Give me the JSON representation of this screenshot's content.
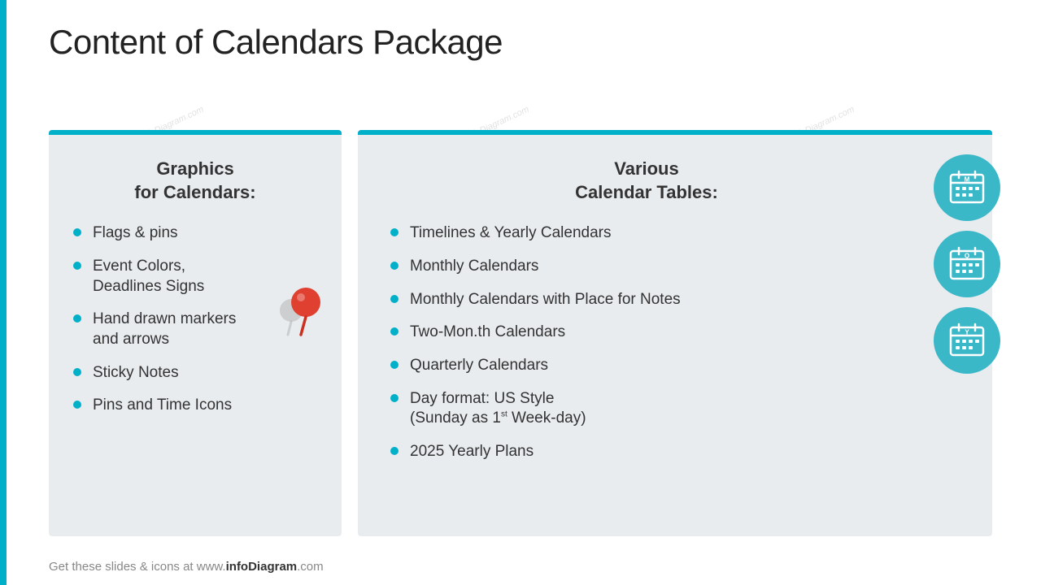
{
  "page": {
    "title": "Content of Calendars Package",
    "left_accent_color": "#00b0c8"
  },
  "left_panel": {
    "title_line1": "Graphics",
    "title_line2": "for Calendars:",
    "items": [
      "Flags & pins",
      "Event Colors, Deadlines Signs",
      "Hand drawn markers and arrows",
      "Sticky Notes",
      "Pins and Time Icons"
    ]
  },
  "right_panel": {
    "title_line1": "Various",
    "title_line2": "Calendar Tables:",
    "items": [
      {
        "text": "Timelines & Yearly Calendars",
        "sup": null
      },
      {
        "text": "Monthly Calendars",
        "sup": null
      },
      {
        "text": "Monthly Calendars with Place for Notes",
        "sup": null
      },
      {
        "text": "Two-Mon.th Calendars",
        "sup": null
      },
      {
        "text": "Quarterly Calendars",
        "sup": null
      },
      {
        "text": "Day format: US Style (Sunday as 1st Week-day)",
        "sup": "st"
      },
      {
        "text": "2025 Yearly Plans",
        "sup": null
      }
    ]
  },
  "calendar_icons": [
    {
      "letter": "M",
      "aria": "monthly-calendar-icon"
    },
    {
      "letter": "Q",
      "aria": "quarterly-calendar-icon"
    },
    {
      "letter": "Y",
      "aria": "yearly-calendar-icon"
    }
  ],
  "footer": {
    "text_before": "Get these slides & icons at www.",
    "brand": "infoDiagram",
    "text_after": ".com"
  },
  "watermarks": [
    "© infoDiagram.com",
    "© infoDiagram.com",
    "© infoDiagram.com"
  ]
}
